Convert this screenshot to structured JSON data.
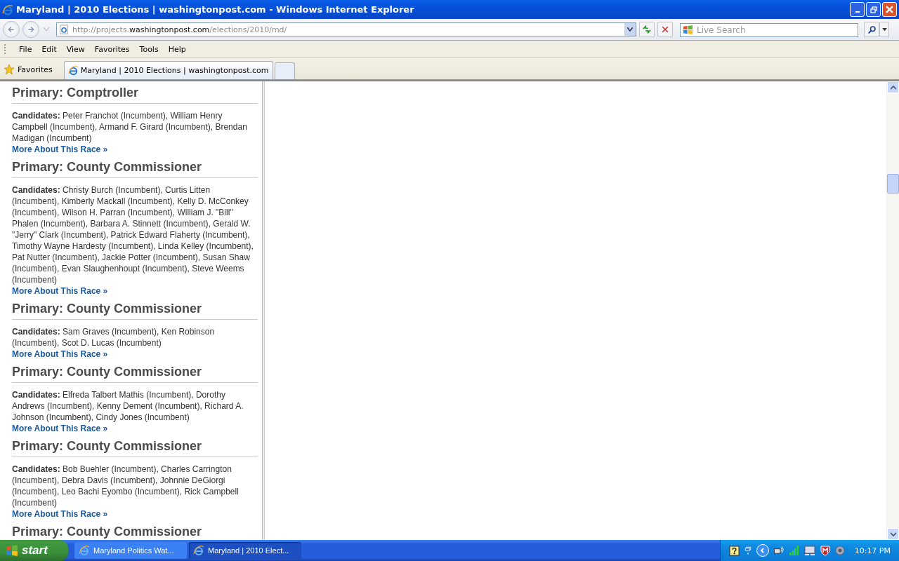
{
  "window": {
    "title": "Maryland | 2010 Elections | washingtonpost.com - Windows Internet Explorer"
  },
  "address": {
    "prefix": "http://projects.",
    "domain": "washingtonpost.com",
    "path": "/elections/2010/md/"
  },
  "search": {
    "placeholder": "Live Search"
  },
  "menu": [
    "File",
    "Edit",
    "View",
    "Favorites",
    "Tools",
    "Help"
  ],
  "favorites": {
    "label": "Favorites"
  },
  "tabs": [
    {
      "label": "Maryland | 2010 Elections | washingtonpost.com",
      "selected": true
    }
  ],
  "races": [
    {
      "title": "Primary: Comptroller",
      "label": "Candidates:",
      "candidates": "Peter Franchot (Incumbent), William Henry Campbell (Incumbent), Armand F. Girard (Incumbent), Brendan Madigan (Incumbent)",
      "link": "More About This Race »"
    },
    {
      "title": "Primary: County Commissioner",
      "label": "Candidates:",
      "candidates": "Christy Burch (Incumbent), Curtis Litten (Incumbent), Kimberly Mackall (Incumbent), Kelly D. McConkey (Incumbent), Wilson H. Parran (Incumbent), William J. \"Bill\" Phalen (Incumbent), Barbara A. Stinnett (Incumbent), Gerald W. \"Jerry\" Clark (Incumbent), Patrick Edward Flaherty (Incumbent), Timothy Wayne Hardesty (Incumbent), Linda Kelley (Incumbent), Pat Nutter (Incumbent), Jackie Potter (Incumbent), Susan Shaw (Incumbent), Evan Slaughenhoupt (Incumbent), Steve Weems (Incumbent)",
      "link": "More About This Race »"
    },
    {
      "title": "Primary: County Commissioner",
      "label": "Candidates:",
      "candidates": "Sam Graves (Incumbent), Ken Robinson (Incumbent), Scot D. Lucas (Incumbent)",
      "link": "More About This Race »"
    },
    {
      "title": "Primary: County Commissioner",
      "label": "Candidates:",
      "candidates": "Elfreda Talbert Mathis (Incumbent), Dorothy Andrews (Incumbent), Kenny Dement (Incumbent), Richard A. Johnson (Incumbent), Cindy Jones (Incumbent)",
      "link": "More About This Race »"
    },
    {
      "title": "Primary: County Commissioner",
      "label": "Candidates:",
      "candidates": "Bob Buehler (Incumbent), Charles Carrington (Incumbent), Debra Davis (Incumbent), Johnnie DeGiorgi (Incumbent), Leo Bachi Eyombo (Incumbent), Rick Campbell (Incumbent)",
      "link": "More About This Race »"
    },
    {
      "title": "Primary: County Commissioner"
    }
  ],
  "taskbar": {
    "start": "start",
    "tasks": [
      {
        "label": "Maryland Politics Wat...",
        "selected": false
      },
      {
        "label": "Maryland | 2010 Elect...",
        "selected": true
      }
    ],
    "clock": "10:17 PM"
  }
}
